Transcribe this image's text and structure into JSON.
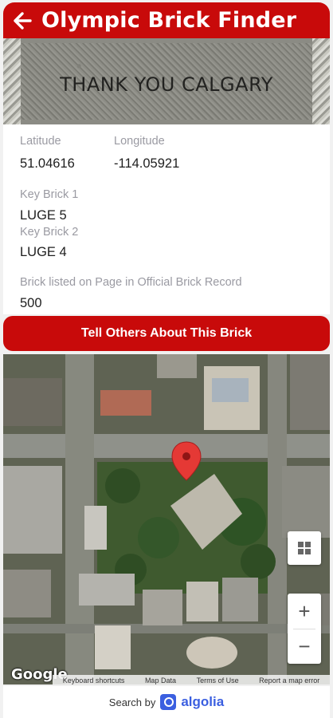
{
  "header": {
    "title": "Olympic Brick Finder",
    "back_icon": "arrow-left-icon"
  },
  "brick_photo": {
    "engraving": "THANK YOU CALGARY"
  },
  "details": {
    "latitude_label": "Latitude",
    "latitude_value": "51.04616",
    "longitude_label": "Longitude",
    "longitude_value": "-114.05921",
    "key_brick_1_label": "Key Brick 1",
    "key_brick_1_value": "LUGE 5",
    "key_brick_2_label": "Key Brick 2",
    "key_brick_2_value": "LUGE 4",
    "page_label": "Brick listed on Page in Official Brick Record",
    "page_value": "500"
  },
  "share_button": {
    "label": "Tell Others About This Brick"
  },
  "map": {
    "google_logo": "Google",
    "attribution": [
      "Keyboard shortcuts",
      "Map Data",
      "Terms of Use",
      "Report a map error"
    ],
    "controls": {
      "layers_icon": "grid-icon",
      "zoom_in": "+",
      "zoom_out": "−"
    },
    "marker_icon": "map-pin-icon",
    "marker_color": "#e53935"
  },
  "footer": {
    "search_by": "Search by",
    "brand": "algolia"
  },
  "colors": {
    "accent": "#c80a0a",
    "algolia": "#3b5fe0"
  }
}
